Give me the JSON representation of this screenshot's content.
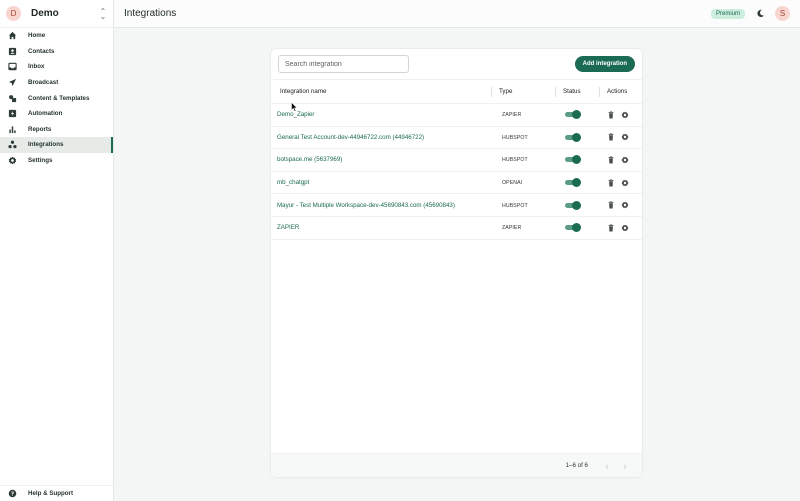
{
  "workspace": {
    "initial": "D",
    "name": "Demo"
  },
  "header": {
    "title": "Integrations",
    "badge": "Premium",
    "user_initial": "S"
  },
  "sidebar": {
    "items": [
      {
        "label": "Home",
        "icon": "home-icon"
      },
      {
        "label": "Contacts",
        "icon": "contacts-icon"
      },
      {
        "label": "Inbox",
        "icon": "inbox-icon"
      },
      {
        "label": "Broadcast",
        "icon": "send-icon"
      },
      {
        "label": "Content & Templates",
        "icon": "templates-icon"
      },
      {
        "label": "Automation",
        "icon": "automation-icon"
      },
      {
        "label": "Reports",
        "icon": "reports-icon"
      },
      {
        "label": "Integrations",
        "icon": "integrations-icon",
        "active": true
      },
      {
        "label": "Settings",
        "icon": "gear-icon"
      }
    ],
    "help_label": "Help & Support"
  },
  "toolbar": {
    "search_placeholder": "Search integration",
    "search_value": "",
    "add_label": "Add integration"
  },
  "table": {
    "columns": [
      "Integration name",
      "Type",
      "Status",
      "Actions"
    ],
    "rows": [
      {
        "name": "Demo_Zapier",
        "type": "ZAPIER",
        "enabled": true
      },
      {
        "name": "General Test Account-dev-44946722.com (44946722)",
        "type": "HUBSPOT",
        "enabled": true
      },
      {
        "name": "botspace.me (5637969)",
        "type": "HUBSPOT",
        "enabled": true
      },
      {
        "name": "mb_chatgpt",
        "type": "OPENAI",
        "enabled": true
      },
      {
        "name": "Mayur - Test Multiple Workspace-dev-45690843.com (45690843)",
        "type": "HUBSPOT",
        "enabled": true
      },
      {
        "name": "ZAPIER",
        "type": "ZAPIER",
        "enabled": true
      }
    ]
  },
  "pagination": {
    "range": "1–6 of 6"
  },
  "colors": {
    "accent": "#1b6b53",
    "badge_bg": "#cdeede",
    "avatar_bg": "#f8d6cf"
  }
}
